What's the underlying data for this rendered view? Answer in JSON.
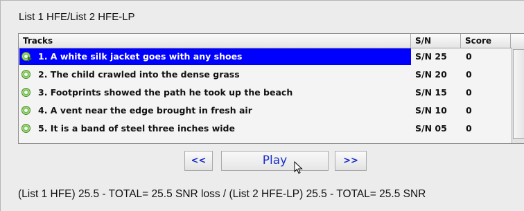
{
  "panel": {
    "title": "List 1 HFE/List 2 HFE-LP"
  },
  "table": {
    "columns": [
      "Tracks",
      "S/N",
      "Score"
    ],
    "rows": [
      {
        "track": "1. A white silk jacket goes with any shoes",
        "sn": "S/N 25",
        "score": "0",
        "selected": true
      },
      {
        "track": "2. The child crawled into the dense grass",
        "sn": "S/N 20",
        "score": "0",
        "selected": false
      },
      {
        "track": "3. Footprints showed the path he took up the beach",
        "sn": "S/N 15",
        "score": "0",
        "selected": false
      },
      {
        "track": "4. A vent near the edge brought in fresh air",
        "sn": "S/N 10",
        "score": "0",
        "selected": false
      },
      {
        "track": "5. It is a band of steel three inches wide",
        "sn": "S/N 05",
        "score": "0",
        "selected": false
      }
    ]
  },
  "controls": {
    "prev_label": "<<",
    "play_label": "Play",
    "next_label": ">>"
  },
  "summary": {
    "text": "(List 1 HFE) 25.5 - TOTAL= 25.5 SNR loss / (List 2 HFE-LP) 25.5 - TOTAL= 25.5 SNR"
  },
  "colors": {
    "selection": "#0000ff",
    "button_text": "#1a2ec9"
  },
  "icons": {
    "track": "cd-disc-icon",
    "playing": "play-arrow-icon"
  }
}
